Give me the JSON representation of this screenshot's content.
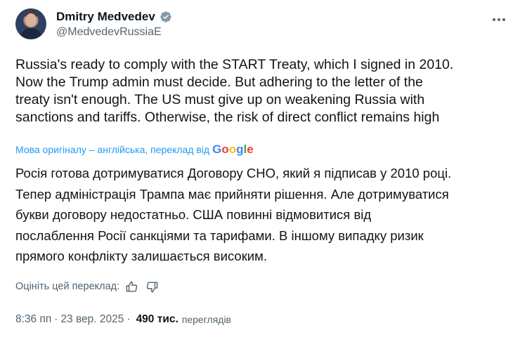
{
  "author": {
    "display_name": "Dmitry Medvedev",
    "handle": "@MedvedevRussiaE",
    "verified": true,
    "verified_color": "#1d9bf0"
  },
  "tweet": {
    "text_lines": [
      "Russia's ready to comply with the START Treaty, which I signed in 2010.",
      "Now the Trump admin must decide. But adhering to the letter of the",
      "treaty isn't enough. The US must give up on weakening Russia with",
      "sanctions and tariffs. Otherwise, the risk of direct conflict remains high"
    ]
  },
  "translation": {
    "attribution": "Мова оригіналу – англійська, переклад від",
    "provider": "Google",
    "text_lines": [
      "Росія готова дотримуватися Договору СНО, який я підписав у 2010 році.",
      "Тепер адміністрація Трампа має прийняти рішення. Але дотримуватися",
      "букви договору недостатньо. США повинні відмовитися від",
      "послаблення Росії санкціями та тарифами. В іншому випадку ризик",
      "прямого конфлікту залишається високим."
    ],
    "rate_label": "Оцініть цей переклад:"
  },
  "meta": {
    "time": "8:36 пп",
    "separator": "·",
    "date": "23 вер. 2025",
    "views_count": "490 тис.",
    "views_label": "переглядів"
  },
  "colors": {
    "text": "#0f1419",
    "secondary": "#536471",
    "link": "#1d9bf0"
  },
  "icons": [
    "verified-badge-icon",
    "more-options-icon",
    "thumbs-up-icon",
    "thumbs-down-icon"
  ]
}
